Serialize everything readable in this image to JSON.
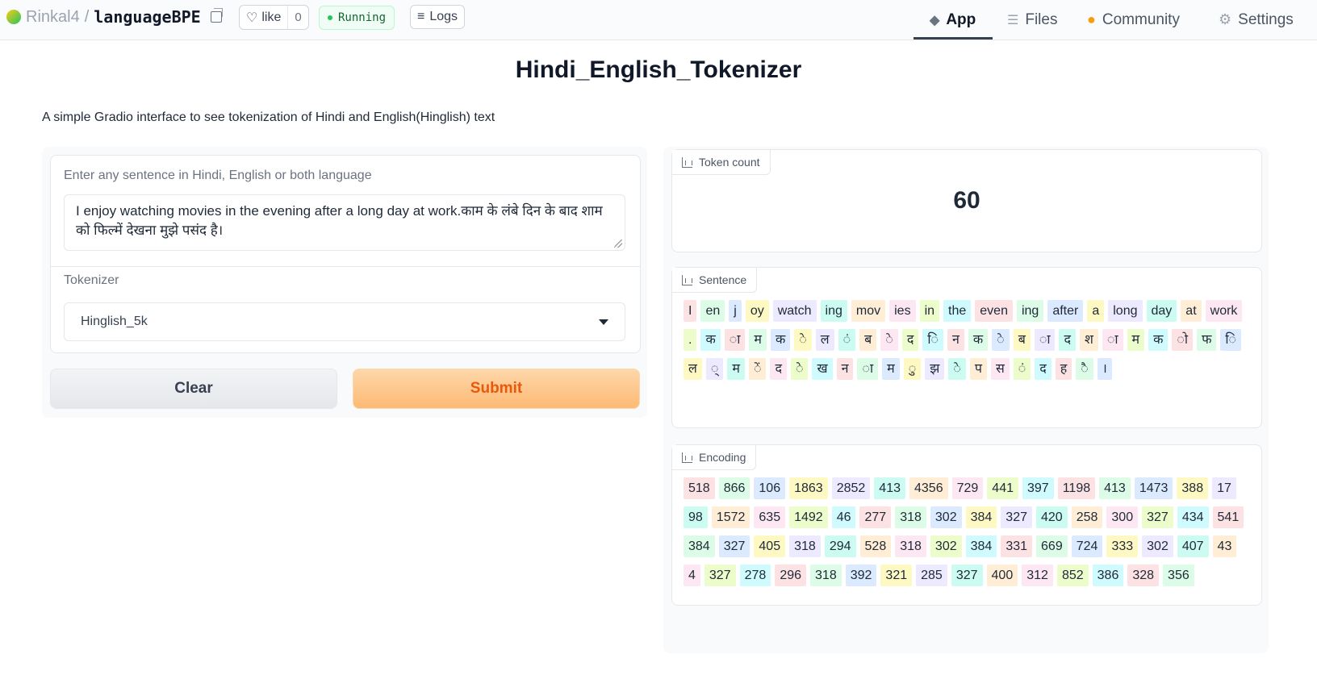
{
  "topbar": {
    "owner": "Rinkal4",
    "repo": "languageBPE",
    "like_label": "like",
    "like_count": "0",
    "status": "Running",
    "logs_label": "Logs",
    "nav": {
      "app": "App",
      "files": "Files",
      "community": "Community",
      "settings": "Settings"
    }
  },
  "page": {
    "title": "Hindi_English_Tokenizer",
    "description": "A simple Gradio interface to see tokenization of Hindi and English(Hinglish) text"
  },
  "input": {
    "sentence_label": "Enter any sentence in Hindi, English or both language",
    "sentence_value": "I enjoy watching movies in the evening after a long day at work.काम के लंबे दिन के बाद शाम को फिल्में देखना मुझे पसंद है।",
    "tokenizer_label": "Tokenizer",
    "tokenizer_value": "Hinglish_5k"
  },
  "buttons": {
    "clear": "Clear",
    "submit": "Submit"
  },
  "output": {
    "token_count_label": "Token count",
    "token_count": "60",
    "sentence_label": "Sentence",
    "encoding_label": "Encoding",
    "sentence_tokens": [
      "I",
      "en",
      "j",
      "oy",
      "watch",
      "ing",
      "mov",
      "ies",
      "in",
      "the",
      "even",
      "ing",
      "after",
      "a",
      "long",
      "day",
      "at",
      "work",
      ".",
      "क",
      "ा",
      "म",
      "क",
      "े",
      "ल",
      "ं",
      "ब",
      "े",
      "द",
      "ि",
      "न",
      "क",
      "े",
      "ब",
      "ा",
      "द",
      "श",
      "ा",
      "म",
      "क",
      "ो",
      "फ",
      "ि",
      "ल",
      "्",
      "म",
      "ें",
      "द",
      "े",
      "ख",
      "न",
      "ा",
      "म",
      "ु",
      "झ",
      "े",
      "प",
      "स",
      "ं",
      "द",
      "ह",
      "ै",
      "।"
    ],
    "encoding_tokens": [
      "518",
      "866",
      "106",
      "1863",
      "2852",
      "413",
      "4356",
      "729",
      "441",
      "397",
      "1198",
      "413",
      "1473",
      "388",
      "17",
      "98",
      "1572",
      "635",
      "1492",
      "46",
      "277",
      "318",
      "302",
      "384",
      "327",
      "420",
      "258",
      "300",
      "327",
      "434",
      "541",
      "384",
      "327",
      "405",
      "318",
      "294",
      "528",
      "318",
      "302",
      "384",
      "331",
      "669",
      "724",
      "333",
      "302",
      "407",
      "43",
      "4",
      "327",
      "278",
      "296",
      "318",
      "392",
      "321",
      "285",
      "327",
      "400",
      "312",
      "852",
      "386",
      "328",
      "356"
    ]
  },
  "colors": {
    "accent": "#ea580c",
    "running": "#22c55e"
  }
}
